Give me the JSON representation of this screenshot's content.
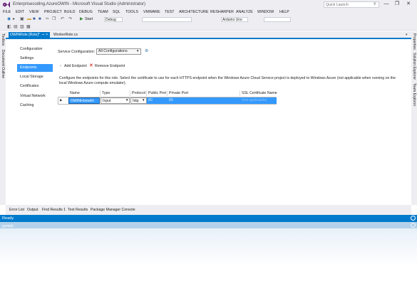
{
  "window": {
    "title": "Enterprisecoding.AzureOWIN - Microsoft Visual Studio (Administrator)",
    "quick_launch_placeholder": "Quick Launch",
    "minimize": "—",
    "restore": "❐",
    "close": "✕"
  },
  "menu": [
    "FILE",
    "EDIT",
    "VIEW",
    "PROJECT",
    "BUILD",
    "DEBUG",
    "TEAM",
    "SQL",
    "TOOLS",
    "VMWARE",
    "TEST",
    "ARCHITECTURE",
    "RESHARPER",
    "ANALYZE",
    "WINDOW",
    "HELP"
  ],
  "toolbar": {
    "start_label": "Start",
    "config_value": "Debug",
    "device_value": "Arduino Uno"
  },
  "side_left": [
    "Toolbox",
    "Document Outline"
  ],
  "side_right": [
    "Properties",
    "Solution Explorer",
    "Team Explorer"
  ],
  "tabs": {
    "active": "OWINRole [Role]*",
    "inactive": "WorkerRole.cs",
    "pin": "⊸",
    "close": "×"
  },
  "nav": {
    "items": [
      "Configuration",
      "Settings",
      "Endpoints",
      "Local Storage",
      "Certificates",
      "Virtual Network",
      "Caching"
    ],
    "selected": "Endpoints"
  },
  "service_config": {
    "label": "Service Configuration:",
    "value": "All Configurations"
  },
  "actions": {
    "add": "Add Endpoint",
    "remove": "Remove Endpoint"
  },
  "description": "Configure the endpoints for this role.  Select the certificate to use for each HTTPS endpoint when the Windows Azure Cloud Service project is deployed to Windows Azure (not applicable when running on the local Windows Azure compute emulator).",
  "grid": {
    "columns": [
      "Name",
      "Type",
      "Protocol",
      "Public Port",
      "Private Port",
      "SSL Certificate Name"
    ],
    "row": {
      "name": "OWINHomeEI",
      "type": "Input",
      "protocol": "http",
      "public_port": "80",
      "private_port": "80",
      "ssl_certificate_name": "(not applicable)"
    }
  },
  "bottom_tabs": [
    "Error List",
    "Output",
    "Find Results 1",
    "Test Results",
    "Package Manager Console"
  ],
  "status": {
    "text": "Ready",
    "accent": "#007acc"
  },
  "icons": {
    "logo": "visual-studio-logo",
    "search": "search-icon",
    "remove": "red-x-icon"
  }
}
